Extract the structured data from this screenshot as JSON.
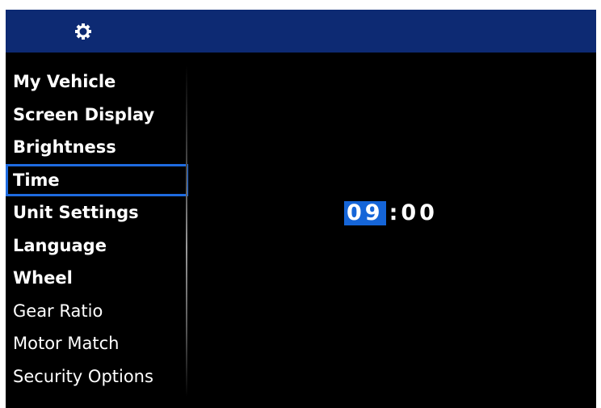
{
  "header": {
    "icon": "gear-icon"
  },
  "menu": {
    "items": [
      {
        "label": "My Vehicle"
      },
      {
        "label": "Screen Display"
      },
      {
        "label": "Brightness"
      },
      {
        "label": "Time"
      },
      {
        "label": "Unit Settings"
      },
      {
        "label": "Language"
      },
      {
        "label": "Wheel"
      },
      {
        "label": "Gear Ratio"
      },
      {
        "label": "Motor Match"
      },
      {
        "label": "Security Options"
      }
    ],
    "selected": "Time"
  },
  "time": {
    "hours": "09",
    "separator": ":",
    "minutes": "00"
  },
  "colors": {
    "header": "#0d2a73",
    "accent": "#1565d8",
    "background": "#000000",
    "text": "#ffffff"
  }
}
